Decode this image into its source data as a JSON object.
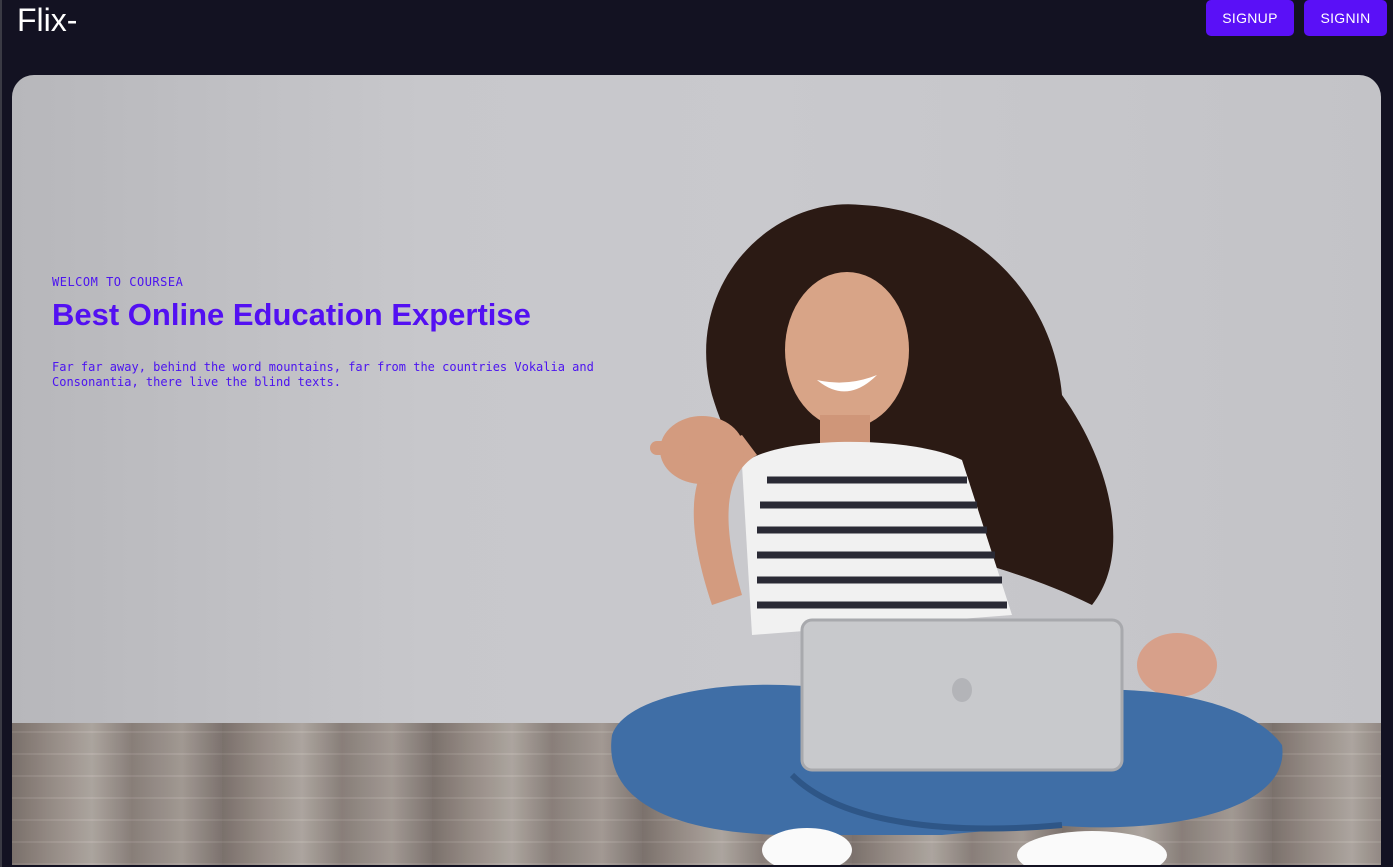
{
  "header": {
    "brand": "Flix-",
    "signup_label": "SIGNUP",
    "signin_label": "SIGNIN"
  },
  "hero": {
    "kicker": "WELCOM TO COURSEA",
    "headline": "Best Online Education Expertise",
    "lead": "Far far away, behind the word mountains, far from the countries Vokalia and Consonantia, there live the blind texts."
  },
  "colors": {
    "background": "#131222",
    "accent": "#5a10f7",
    "hero_text": "#5310f2"
  }
}
